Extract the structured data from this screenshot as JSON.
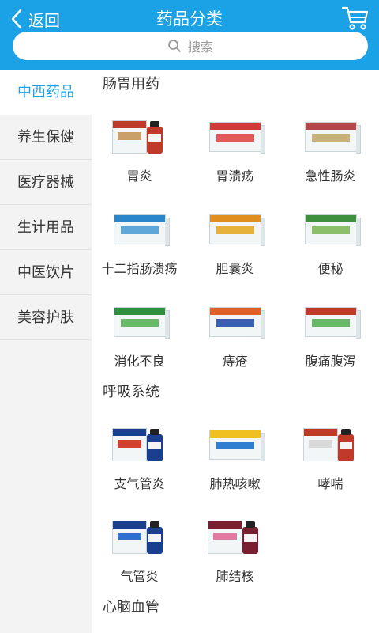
{
  "header": {
    "back_label": "返回",
    "title": "药品分类",
    "cart_icon": "shopping-cart-icon",
    "search_placeholder": "搜索",
    "accent_color": "#1aa1e6"
  },
  "sidebar": {
    "items": [
      {
        "label": "中西药品",
        "active": true
      },
      {
        "label": "养生保健",
        "active": false
      },
      {
        "label": "医疗器械",
        "active": false
      },
      {
        "label": "生计用品",
        "active": false
      },
      {
        "label": "中医饮片",
        "active": false
      },
      {
        "label": "美容护肤",
        "active": false
      }
    ]
  },
  "sections": [
    {
      "title": "肠胃用药",
      "items": [
        {
          "label": "胃炎",
          "kind": "bottle",
          "color": "#c9a06a",
          "band": "#c0392b"
        },
        {
          "label": "胃溃疡",
          "kind": "box",
          "color": "#e05a5a",
          "band": "#d23a3a"
        },
        {
          "label": "急性肠炎",
          "kind": "box",
          "color": "#c9b27a",
          "band": "#b5474b"
        },
        {
          "label": "十二指肠溃疡",
          "kind": "box",
          "color": "#5da8d8",
          "band": "#2b86c9"
        },
        {
          "label": "胆囊炎",
          "kind": "box",
          "color": "#e6b23a",
          "band": "#e08f1f"
        },
        {
          "label": "便秘",
          "kind": "box",
          "color": "#8bbf6a",
          "band": "#3e8f3e"
        },
        {
          "label": "消化不良",
          "kind": "box",
          "color": "#6ab96a",
          "band": "#2f8f3f"
        },
        {
          "label": "痔疮",
          "kind": "box",
          "color": "#3a5fb0",
          "band": "#e0602a"
        },
        {
          "label": "腹痛腹泻",
          "kind": "box",
          "color": "#6ab96a",
          "band": "#c0392b"
        }
      ]
    },
    {
      "title": "呼吸系统",
      "items": [
        {
          "label": "支气管炎",
          "kind": "bottle",
          "color": "#d2402f",
          "band": "#1a3f8f"
        },
        {
          "label": "肺热咳嗽",
          "kind": "box",
          "color": "#2e7fd0",
          "band": "#f0c020"
        },
        {
          "label": "哮喘",
          "kind": "bottle",
          "color": "#d9d9d9",
          "band": "#c0392b"
        },
        {
          "label": "气管炎",
          "kind": "bottle",
          "color": "#2e6fcf",
          "band": "#1a3f8f"
        },
        {
          "label": "肺结核",
          "kind": "bottle",
          "color": "#e07aa0",
          "band": "#7a1f2f"
        }
      ]
    },
    {
      "title": "心脑血管",
      "items": []
    }
  ]
}
